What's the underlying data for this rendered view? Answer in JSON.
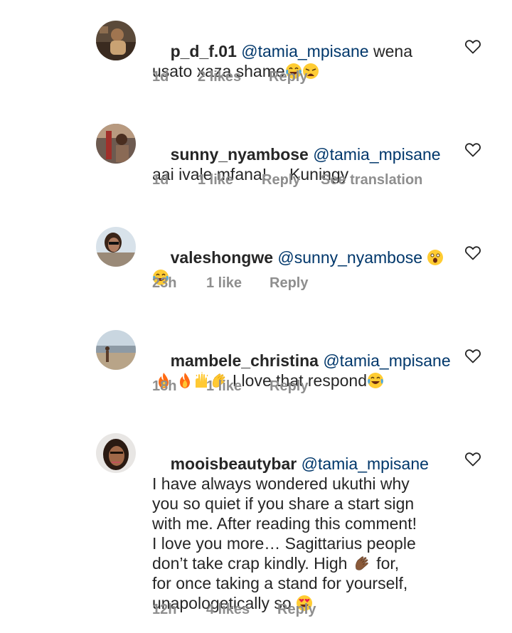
{
  "comments": [
    {
      "username": "p_d_f.01",
      "mention": "@tamia_mpisane",
      "text": " wena\nusato xaza shame",
      "emoji_names": [
        "face-with-tears-of-joy",
        "weary-face"
      ],
      "time": "1d",
      "likes": "2 likes",
      "reply": "Reply",
      "avatar_icon": "user-avatar-photo"
    },
    {
      "username": "sunny_nyambose",
      "mention": "@tamia_mpisane",
      "text": "\naai ivale mfana! ... Kuningy",
      "time": "1d",
      "likes": "1 like",
      "reply": "Reply",
      "translation": "See translation",
      "avatar_icon": "user-avatar-photo"
    },
    {
      "username": "valeshongwe",
      "mention": "@sunny_nyambose",
      "emoji_names": [
        "astonished-face",
        "face-with-tears-of-joy"
      ],
      "time": "23h",
      "likes": "1 like",
      "reply": "Reply",
      "avatar_icon": "user-avatar-photo"
    },
    {
      "username": "mambele_christina",
      "mention": "@tamia_mpisane",
      "text": " I love that respond",
      "emoji_names": [
        "fire",
        "fire",
        "raising-hands",
        "clapping-hands",
        "face-with-tears-of-joy"
      ],
      "time": "18h",
      "likes": "1 like",
      "reply": "Reply",
      "avatar_icon": "user-avatar-photo"
    },
    {
      "username": "mooisbeautybar",
      "mention": "@tamia_mpisane",
      "text_part1": "\nI have always wondered ukuthi why\nyou so quiet if you share a start sign\nwith me. After reading this comment!\nI love you more… Sagittarius people\ndon’t take crap kindly. High ",
      "text_part2": " for,\nfor once taking a stand for yourself,\nunapologetically so ",
      "emoji_names": [
        "clapping-hands-dark",
        "smiling-face-with-heart-eyes"
      ],
      "time": "12h",
      "likes": "4 likes",
      "reply": "Reply",
      "avatar_icon": "user-avatar-photo"
    }
  ],
  "colors": {
    "text": "#262626",
    "mention": "#00376b",
    "meta": "#8e8e8e",
    "background": "#ffffff"
  },
  "icons": {
    "like": "heart-outline-icon"
  }
}
